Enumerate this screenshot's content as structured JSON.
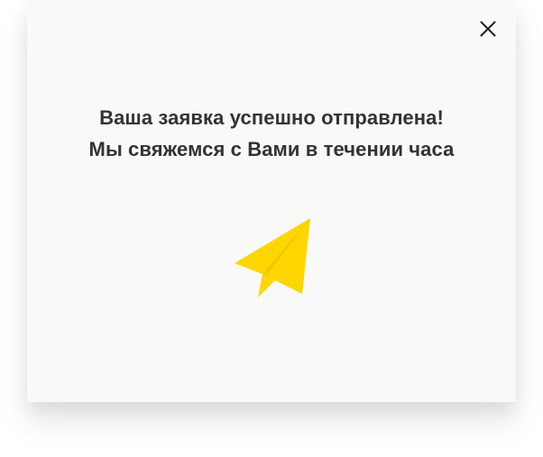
{
  "modal": {
    "close_icon": "close-icon",
    "message_line1": "Ваша заявка успешно отправлена!",
    "message_line2": "Мы свяжемся с Вами в течении часа",
    "illustration_icon": "paper-plane-icon"
  },
  "colors": {
    "accent": "#FFD600",
    "text": "#333333",
    "modal_bg": "#F9F9F9",
    "close_icon": "#222222"
  }
}
